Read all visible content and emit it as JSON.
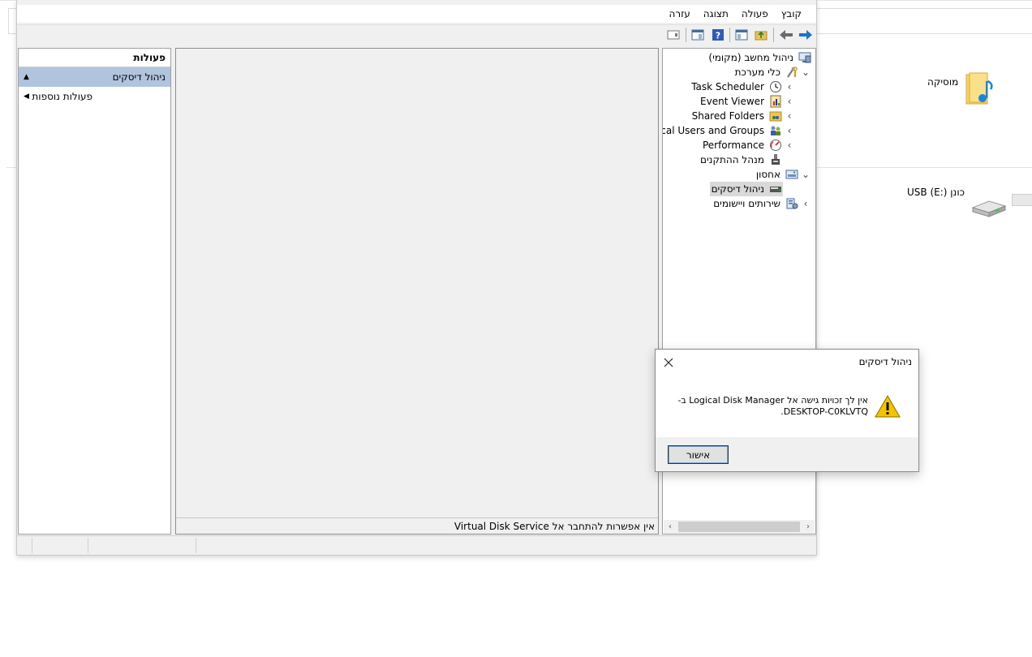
{
  "background_window": {
    "items": [
      {
        "label": "מוסיקה",
        "icon": "music-folder-icon"
      },
      {
        "label": "כונן USB (E:)",
        "icon": "usb-drive-icon"
      }
    ]
  },
  "mmc": {
    "menu": [
      "קובץ",
      "פעולה",
      "תצוגה",
      "עזרה"
    ],
    "tree": {
      "root": "ניהול מחשב (מקומי)",
      "system_tools": "כלי מערכת",
      "task_scheduler": "Task Scheduler",
      "event_viewer": "Event Viewer",
      "shared_folders": "Shared Folders",
      "local_users": "Local Users and Groups",
      "performance": "Performance",
      "device_manager": "מנהל ההתקנים",
      "storage": "אחסון",
      "disk_management": "ניהול דיסקים",
      "services": "שירותים ויישומים"
    },
    "center_status": "אין אפשרות להתחבר אל Virtual Disk Service",
    "actions": {
      "header": "פעולות",
      "selected": "ניהול דיסקים",
      "more": "פעולות נוספות"
    }
  },
  "dialog": {
    "title": "ניהול דיסקים",
    "message_line1": "אין לך זכויות גישה אל Logical Disk Manager ב-",
    "message_line2": "DESKTOP-C0KLVTQ.",
    "ok_label": "אישור"
  },
  "colors": {
    "selection": "#b0c4de",
    "accent_blue": "#1a73c9",
    "warning_yellow": "#f5c400"
  }
}
